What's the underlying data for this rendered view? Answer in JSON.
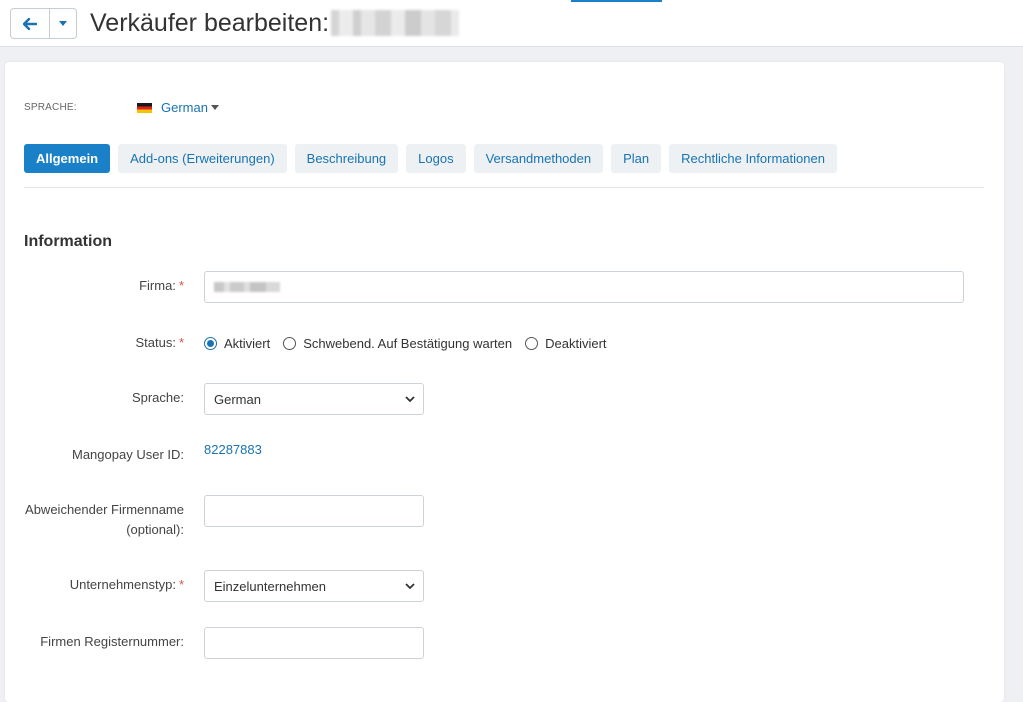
{
  "header": {
    "title": "Verkäufer bearbeiten:",
    "back_icon": "arrow-left-icon",
    "dropdown_icon": "caret-down-icon"
  },
  "language_selector": {
    "label": "SPRACHE:",
    "value": "German"
  },
  "tabs": [
    {
      "label": "Allgemein",
      "active": true
    },
    {
      "label": "Add-ons (Erweiterungen)",
      "active": false
    },
    {
      "label": "Beschreibung",
      "active": false
    },
    {
      "label": "Logos",
      "active": false
    },
    {
      "label": "Versandmethoden",
      "active": false
    },
    {
      "label": "Plan",
      "active": false
    },
    {
      "label": "Rechtliche Informationen",
      "active": false
    }
  ],
  "section": {
    "heading": "Information"
  },
  "form": {
    "firma": {
      "label": "Firma:"
    },
    "status": {
      "label": "Status:",
      "options": [
        {
          "label": "Aktiviert",
          "checked": true
        },
        {
          "label": "Schwebend. Auf Bestätigung warten",
          "checked": false
        },
        {
          "label": "Deaktiviert",
          "checked": false
        }
      ]
    },
    "sprache": {
      "label": "Sprache:",
      "value": "German"
    },
    "mangopay": {
      "label": "Mangopay User ID:",
      "value": "82287883"
    },
    "alt_name": {
      "label": "Abweichender Firmenname (optional):",
      "value": ""
    },
    "unternehmenstyp": {
      "label": "Unternehmenstyp:",
      "value": "Einzelunternehmen"
    },
    "register": {
      "label": "Firmen Registernummer:",
      "value": ""
    }
  },
  "colors": {
    "accent": "#1a80c7",
    "link": "#1a73b0",
    "required": "#d9534f",
    "tab_bg": "#eef1f4"
  }
}
